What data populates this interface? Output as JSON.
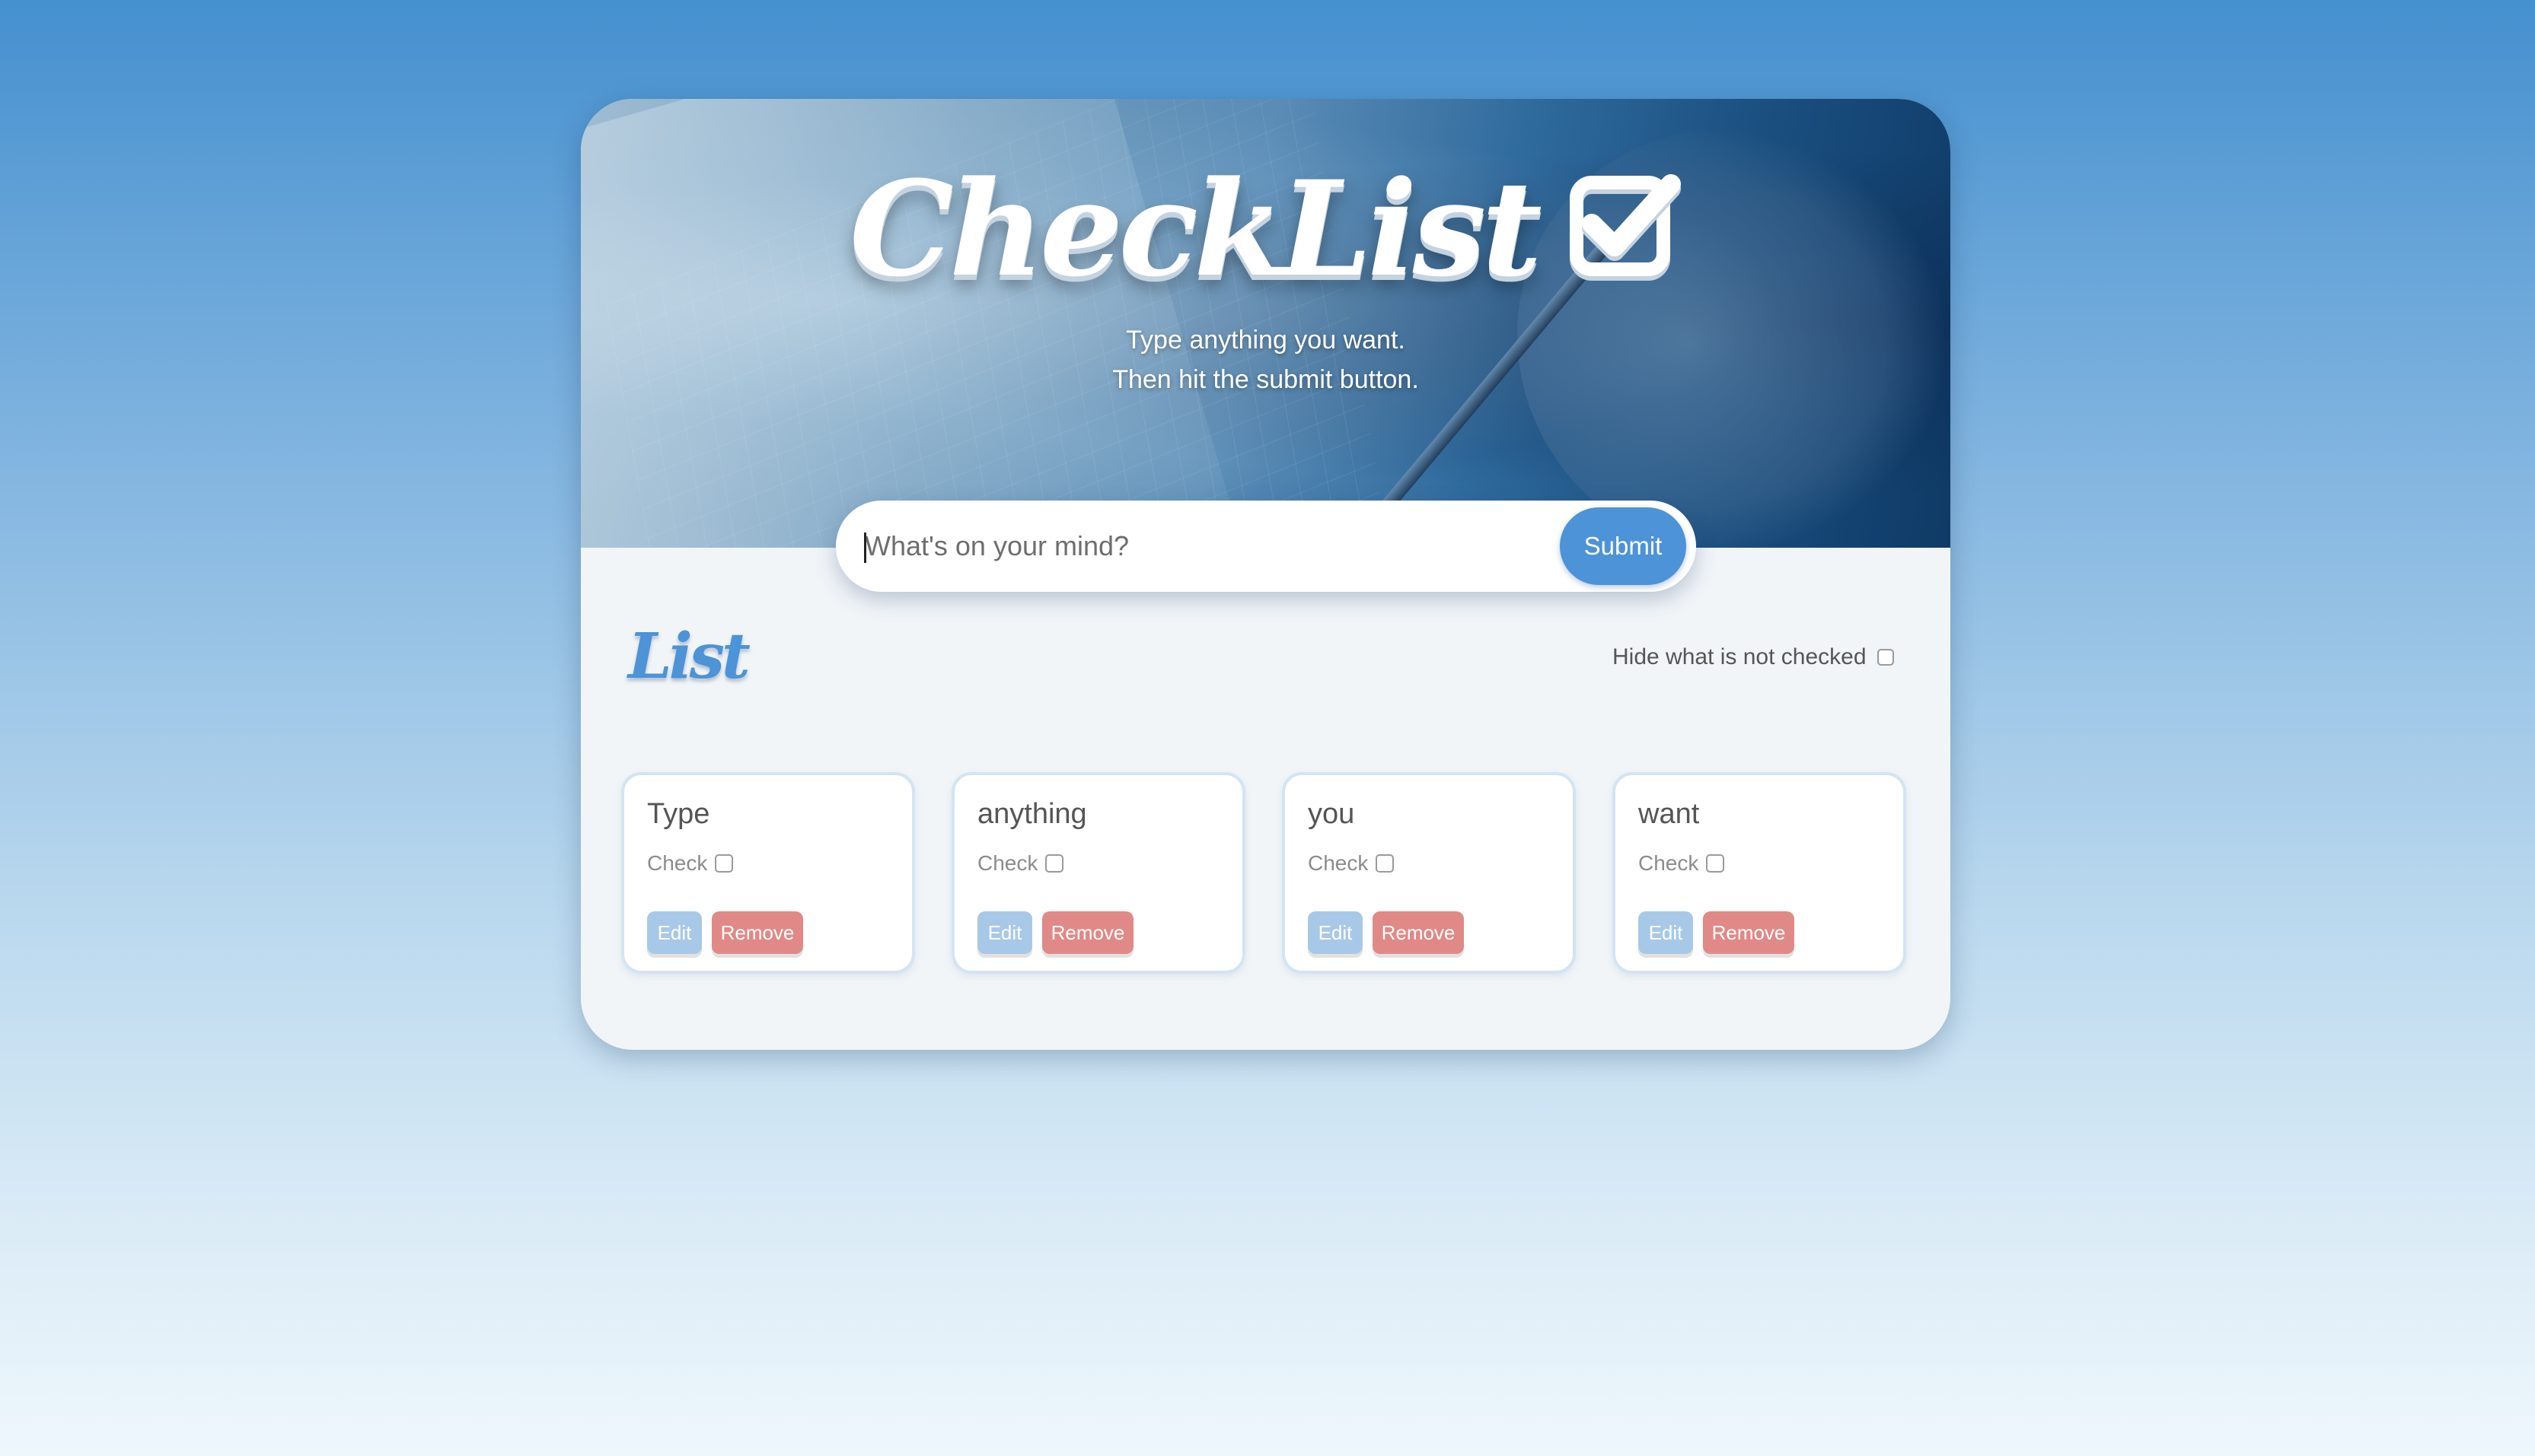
{
  "header": {
    "title": "CheckList",
    "subtitle_line1": "Type anything you want.",
    "subtitle_line2": "Then hit the submit button."
  },
  "input": {
    "placeholder": "What's on your mind?",
    "value": ""
  },
  "submit_label": "Submit",
  "list": {
    "heading": "List",
    "hide_label": "Hide what is not checked",
    "hide_checked": false,
    "items": [
      {
        "title": "Type",
        "check_label": "Check",
        "checked": false,
        "edit_label": "Edit",
        "remove_label": "Remove"
      },
      {
        "title": "anything",
        "check_label": "Check",
        "checked": false,
        "edit_label": "Edit",
        "remove_label": "Remove"
      },
      {
        "title": "you",
        "check_label": "Check",
        "checked": false,
        "edit_label": "Edit",
        "remove_label": "Remove"
      },
      {
        "title": "want",
        "check_label": "Check",
        "checked": false,
        "edit_label": "Edit",
        "remove_label": "Remove"
      }
    ]
  },
  "colors": {
    "accent": "#4c93d8",
    "edit_button": "#a8c8e8",
    "remove_button": "#e08987",
    "card_background": "#f1f5f8"
  },
  "icons": {
    "title_badge": "checkbox-checked-icon"
  }
}
